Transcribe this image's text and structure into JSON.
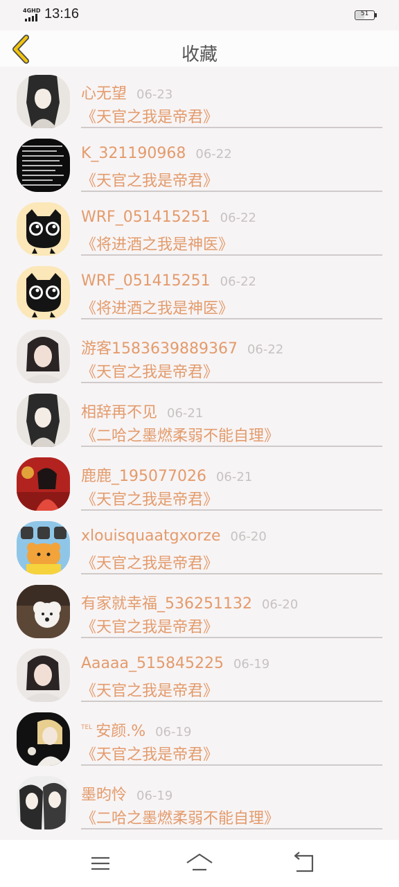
{
  "status_bar": {
    "network": "4GHD",
    "time": "13:16",
    "battery": "51",
    "battery_level": 0.51
  },
  "header": {
    "title": "收藏",
    "back_icon": "chevron-left-icon",
    "accent_color": "#f1c40f"
  },
  "colors": {
    "name": "#e39b6c",
    "book": "#e39b6c",
    "date": "#c7c2c2",
    "divider": "#cfcaca",
    "background": "#f7f4f5"
  },
  "items": [
    {
      "name": "心无望",
      "date": "06-23",
      "book": "《天官之我是帝君》",
      "avatar": "anime-portrait"
    },
    {
      "name": "K_321190968",
      "date": "06-22",
      "book": "《天官之我是帝君》",
      "avatar": "text-image"
    },
    {
      "name": "WRF_051415251",
      "date": "06-22",
      "book": "《将进酒之我是神医》",
      "avatar": "black-cat"
    },
    {
      "name": "WRF_051415251",
      "date": "06-22",
      "book": "《将进酒之我是神医》",
      "avatar": "black-cat"
    },
    {
      "name": "游客1583639889367",
      "date": "06-22",
      "book": "《天官之我是帝君》",
      "avatar": "girl-photo"
    },
    {
      "name": "相辞再不见",
      "date": "06-21",
      "book": "《二哈之墨燃柔弱不能自理》",
      "avatar": "anime-portrait"
    },
    {
      "name": "鹿鹿_195077026",
      "date": "06-21",
      "book": "《天官之我是帝君》",
      "avatar": "red-photo"
    },
    {
      "name": "xlouisquaatgxorze",
      "date": "06-20",
      "book": "《天官之我是帝君》",
      "avatar": "cartoon-bear"
    },
    {
      "name": "有家就幸福_536251132",
      "date": "06-20",
      "book": "《天官之我是帝君》",
      "avatar": "dog-photo"
    },
    {
      "name": "Aaaaa_515845225",
      "date": "06-19",
      "book": "《天官之我是帝君》",
      "avatar": "girl-photo"
    },
    {
      "tel": "TEL",
      "name": "安颜.%",
      "date": "06-19",
      "book": "《天官之我是帝君》",
      "avatar": "blonde-photo"
    },
    {
      "name": "墨昀怜",
      "date": "06-19",
      "book": "《二哈之墨燃柔弱不能自理》",
      "avatar": "anime-pair"
    }
  ],
  "nav_bar": {
    "menu_icon": "menu-icon",
    "home_icon": "home-icon",
    "back_icon": "back-icon"
  }
}
